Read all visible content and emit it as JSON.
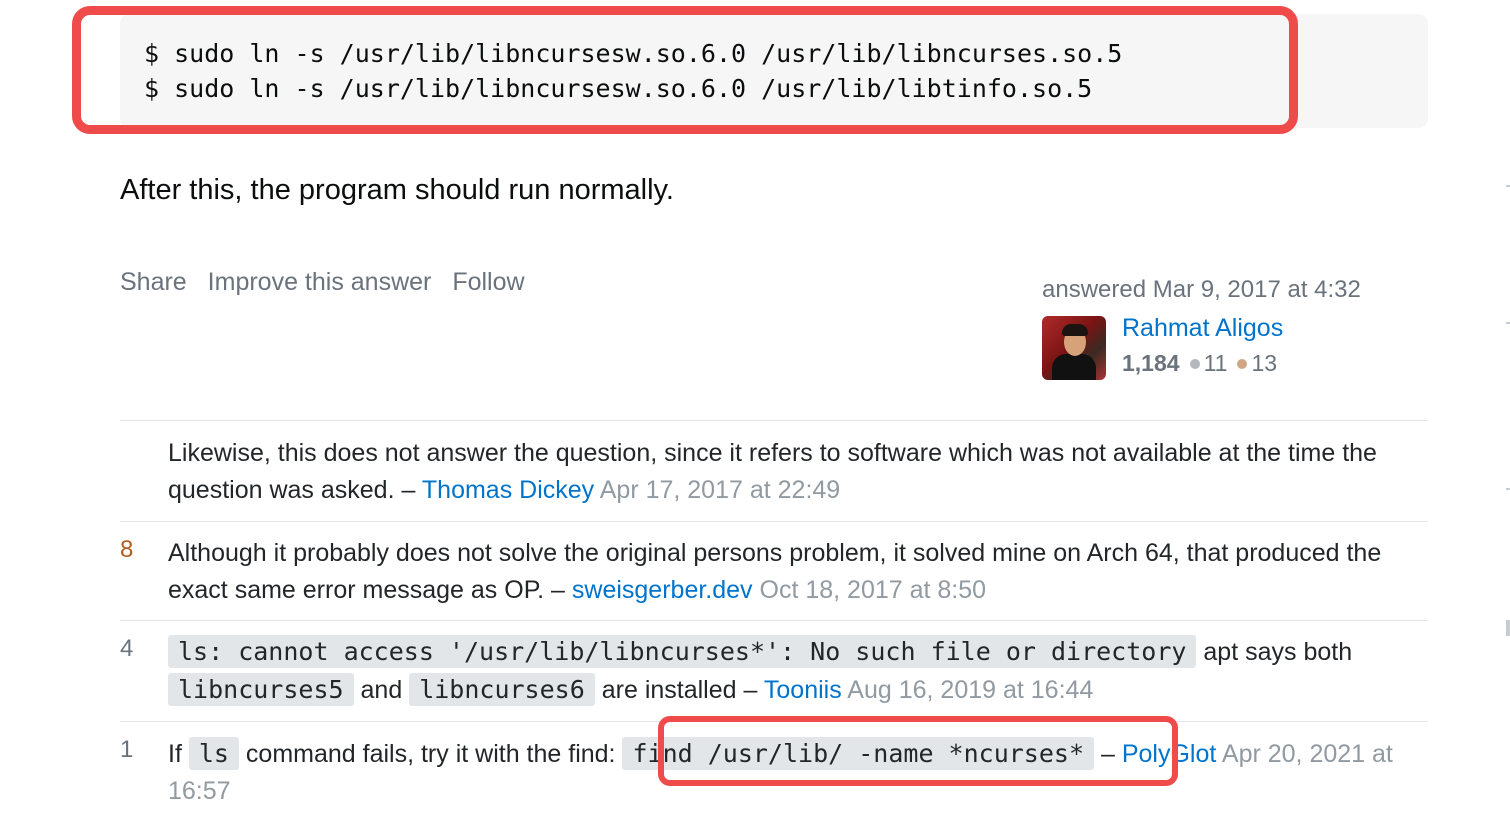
{
  "code_block": {
    "lines": [
      "$ sudo ln -s /usr/lib/libncursesw.so.6.0 /usr/lib/libncurses.so.5",
      "$ sudo ln -s /usr/lib/libncursesw.so.6.0 /usr/lib/libtinfo.so.5"
    ]
  },
  "answer": {
    "paragraph": "After this, the program should run normally."
  },
  "post_menu": {
    "share": "Share",
    "improve": "Improve this answer",
    "follow": "Follow"
  },
  "signature": {
    "action": "answered Mar 9, 2017 at 4:32",
    "user_name": "Rahmat Aligos",
    "reputation": "1,184",
    "silver": "11",
    "bronze": "13"
  },
  "comments": [
    {
      "score": "",
      "text": "Likewise, this does not answer the question, since it refers to software which was not available at the time the question was asked. –",
      "author": "Thomas Dickey",
      "date": "Apr 17, 2017 at 22:49"
    },
    {
      "score": "8",
      "text": "Although it probably does not solve the original persons problem, it solved mine on Arch 64, that produced the exact same error message as OP. –",
      "author": "sweisgerber.dev",
      "date": "Oct 18, 2017 at 8:50"
    },
    {
      "score": "4",
      "code1": "ls: cannot access '/usr/lib/libncurses*': No such file or directory",
      "text_a": "apt says both",
      "code2": "libncurses5",
      "text_b": "and",
      "code3": "libncurses6",
      "text_c": "are installed –",
      "author": "Tooniis",
      "date": "Aug 16, 2019 at 16:44"
    },
    {
      "score": "1",
      "text_a": "If",
      "code1": "ls",
      "text_b": "command fails, try it with the find:",
      "code2": "find /usr/lib/ -name *ncurses*",
      "text_c": "–",
      "author": "PolyGlot",
      "date": "Apr 20, 2021 at 16:57"
    }
  ],
  "colors": {
    "highlight": "#f04b4b",
    "link": "#0074cc"
  }
}
